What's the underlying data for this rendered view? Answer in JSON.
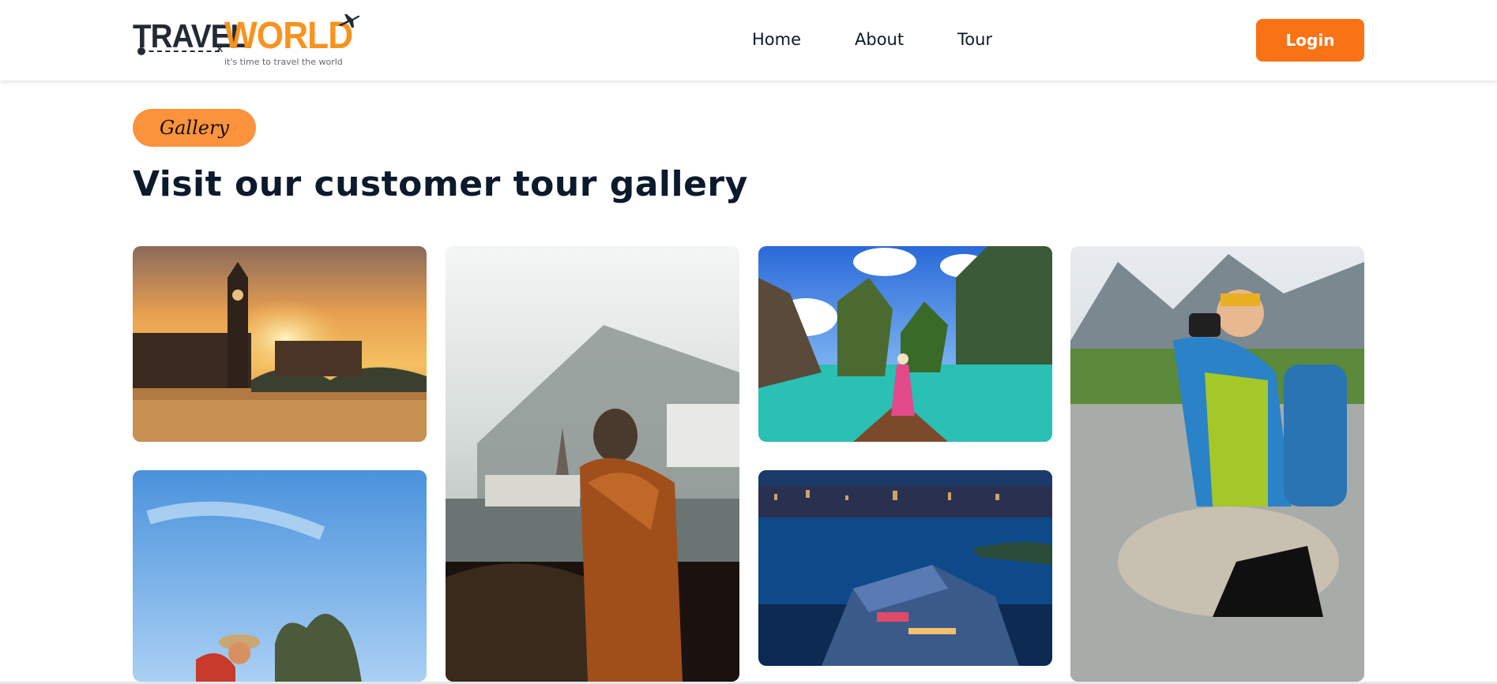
{
  "brand": {
    "name_part1": "TRAVEL",
    "name_part2": "WORLD",
    "tagline": "it's time to travel the world",
    "accent": "#f7931e"
  },
  "nav": {
    "items": [
      "Home",
      "About",
      "Tour"
    ]
  },
  "header": {
    "login_label": "Login",
    "login_color": "#f97316"
  },
  "gallery": {
    "badge": "Gallery",
    "title": "Visit our customer tour gallery",
    "images": [
      {
        "subject": "london-big-ben-sunset"
      },
      {
        "subject": "hallstatt-lake-traveler"
      },
      {
        "subject": "tropical-lagoon-boat-woman"
      },
      {
        "subject": "hiker-photographer-river"
      },
      {
        "subject": "backpacker-rock-island"
      },
      {
        "subject": "night-city-waterfront-aerial"
      }
    ]
  }
}
